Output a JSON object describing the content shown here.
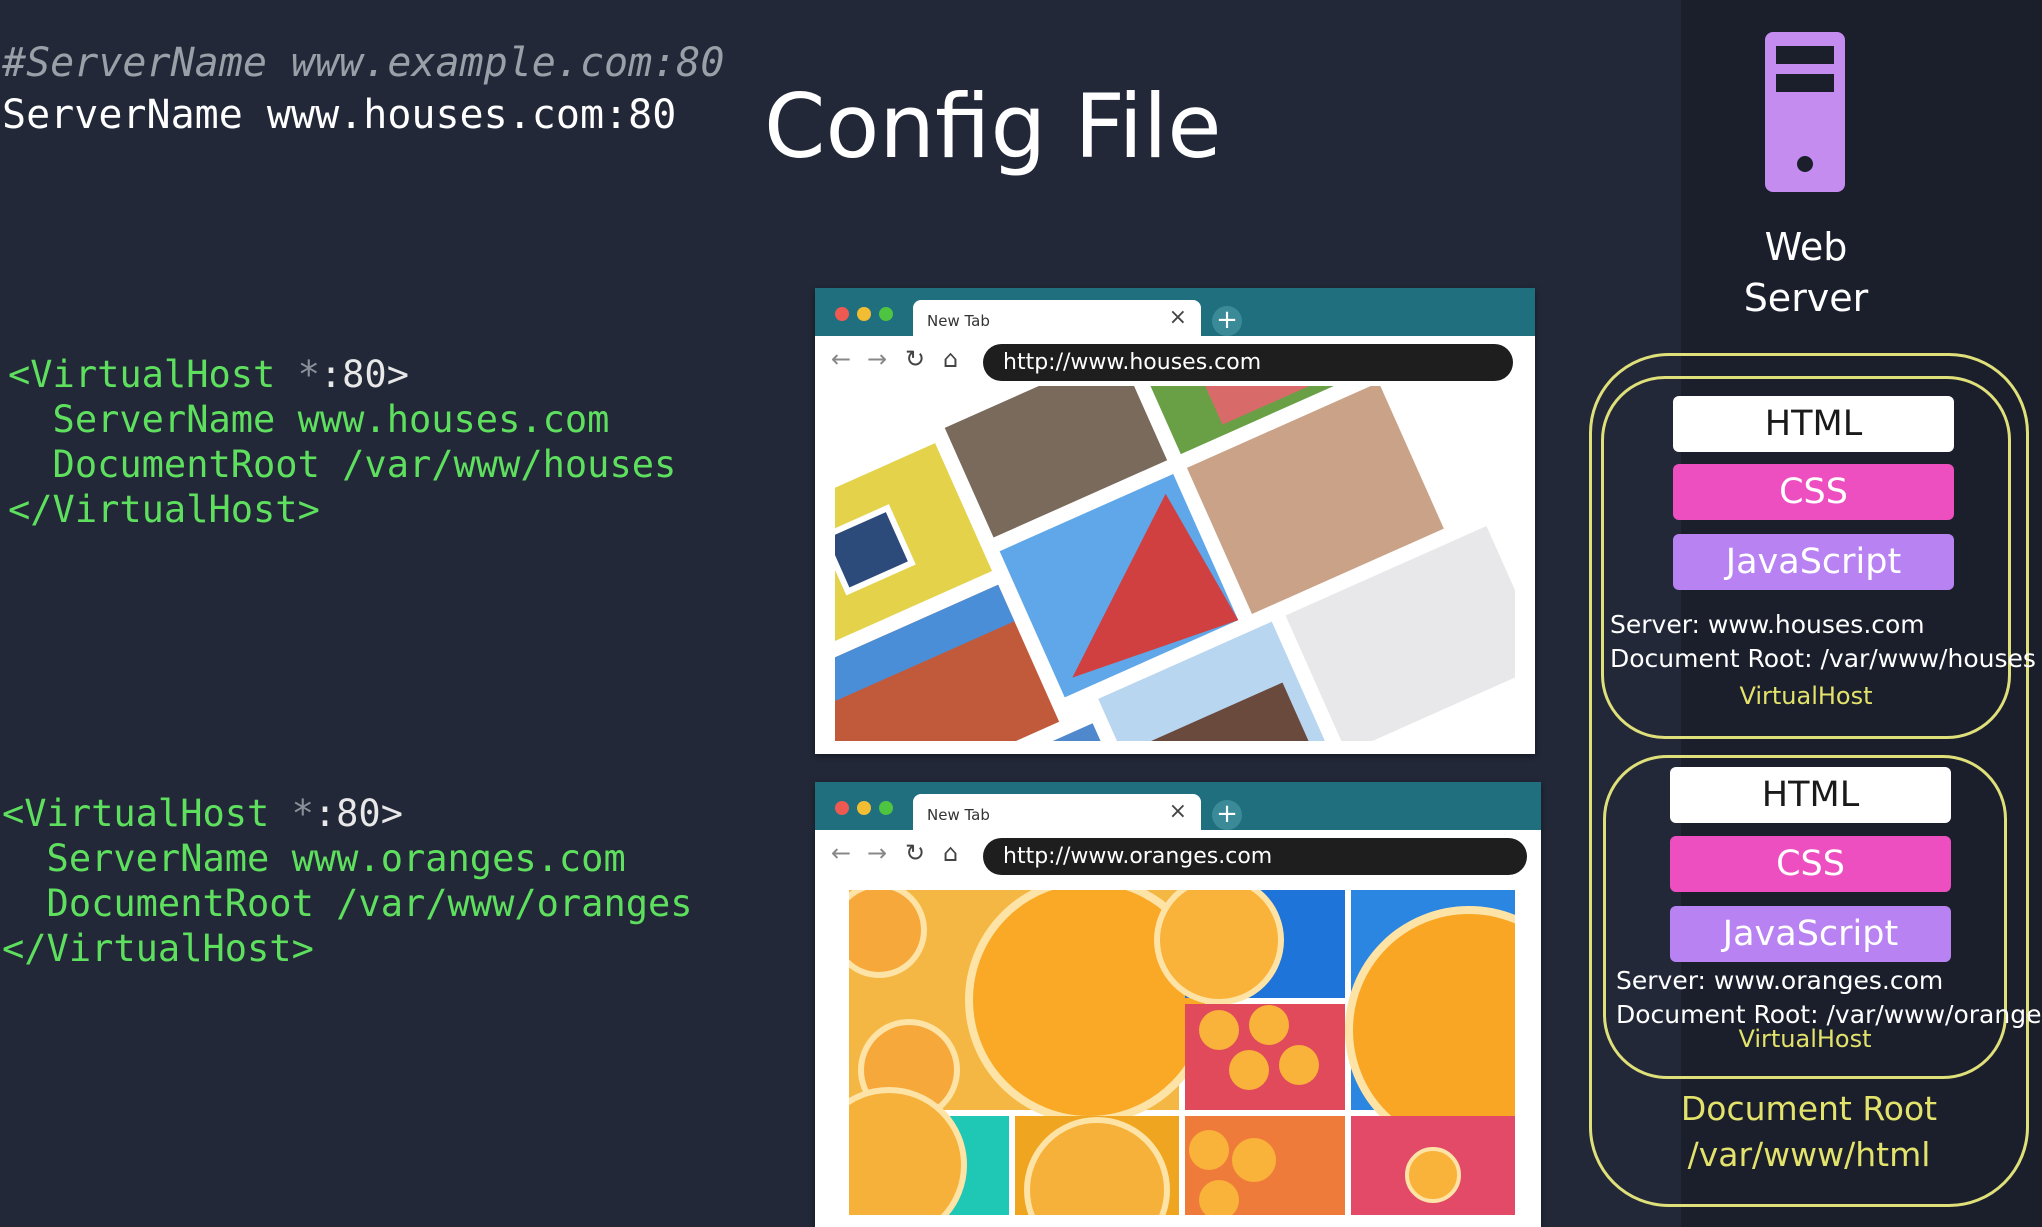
{
  "code": {
    "comment_line": "#ServerName www.example.com:80",
    "server_name_line": "ServerName www.houses.com:80",
    "vhost1": {
      "open_a": "<VirtualHost ",
      "open_b": "*",
      "open_c": ":80>",
      "server_name": "  ServerName www.houses.com",
      "document_root": "  DocumentRoot /var/www/houses",
      "close": "</VirtualHost>"
    },
    "vhost2": {
      "open_a": "<VirtualHost ",
      "open_b": "*",
      "open_c": ":80>",
      "server_name": "  ServerName www.oranges.com",
      "document_root": "  DocumentRoot /var/www/oranges",
      "close": "</VirtualHost>"
    }
  },
  "title": "Config File",
  "browser1": {
    "tab_label": "New Tab",
    "close_symbol": "×",
    "plus_symbol": "+",
    "url": "http://www.houses.com"
  },
  "browser2": {
    "tab_label": "New Tab",
    "close_symbol": "×",
    "plus_symbol": "+",
    "url": "http://www.oranges.com"
  },
  "web_server": {
    "label_line1": "Web",
    "label_line2": "Server",
    "icon": "server-icon",
    "host1": {
      "html": "HTML",
      "css": "CSS",
      "js": "JavaScript",
      "server": "Server: www.houses.com",
      "document_root": "Document Root: /var/www/houses",
      "tag": "VirtualHost"
    },
    "host2": {
      "html": "HTML",
      "css": "CSS",
      "js": "JavaScript",
      "server": "Server: www.oranges.com",
      "document_root": "Document Root: /var/www/oranges",
      "tag": "VirtualHost"
    },
    "document_root_label": "Document Root",
    "document_root_path": "/var/www/html"
  },
  "colors": {
    "background": "#222838",
    "code_green": "#5ee05e",
    "oval_yellow": "#dfe07a",
    "css_pink": "#ee4fc0",
    "js_purple": "#b982f2",
    "browser_teal": "#1f6f7e"
  }
}
